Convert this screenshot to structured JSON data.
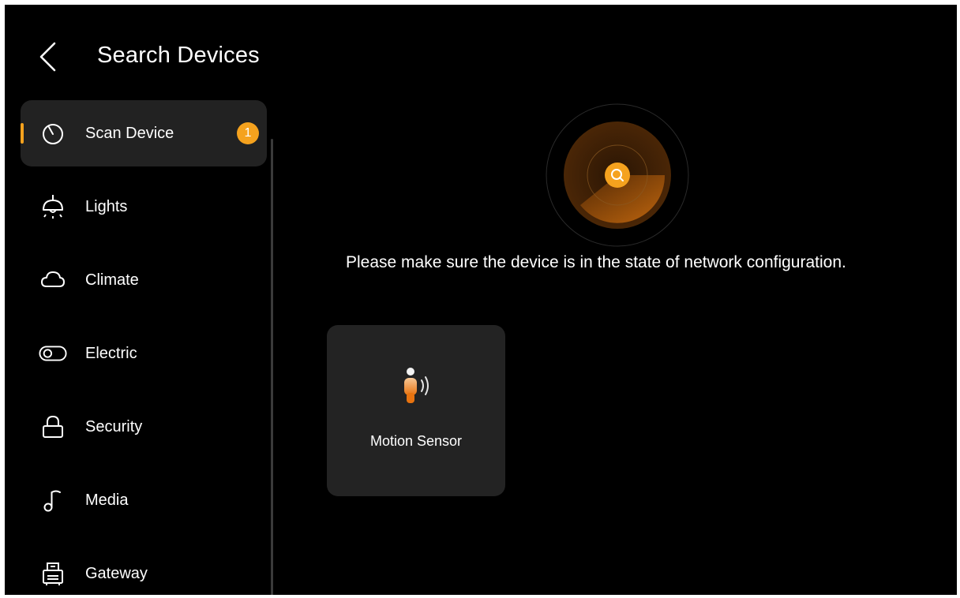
{
  "header": {
    "title": "Search Devices"
  },
  "sidebar": {
    "items": [
      {
        "label": "Scan Device",
        "icon": "scan-icon",
        "badge": "1",
        "active": true
      },
      {
        "label": "Lights",
        "icon": "lamp-icon"
      },
      {
        "label": "Climate",
        "icon": "cloud-icon"
      },
      {
        "label": "Electric",
        "icon": "toggle-switch-icon"
      },
      {
        "label": "Security",
        "icon": "lock-icon"
      },
      {
        "label": "Media",
        "icon": "music-note-icon"
      },
      {
        "label": "Gateway",
        "icon": "router-icon"
      }
    ]
  },
  "main": {
    "hint": "Please make sure the device is in the state of network configuration.",
    "devices": [
      {
        "name": "Motion Sensor",
        "icon": "motion-sensor-icon"
      }
    ]
  },
  "colors": {
    "accent": "#f5a21e",
    "background": "#000000",
    "card": "#232323",
    "active_item": "#222222"
  }
}
